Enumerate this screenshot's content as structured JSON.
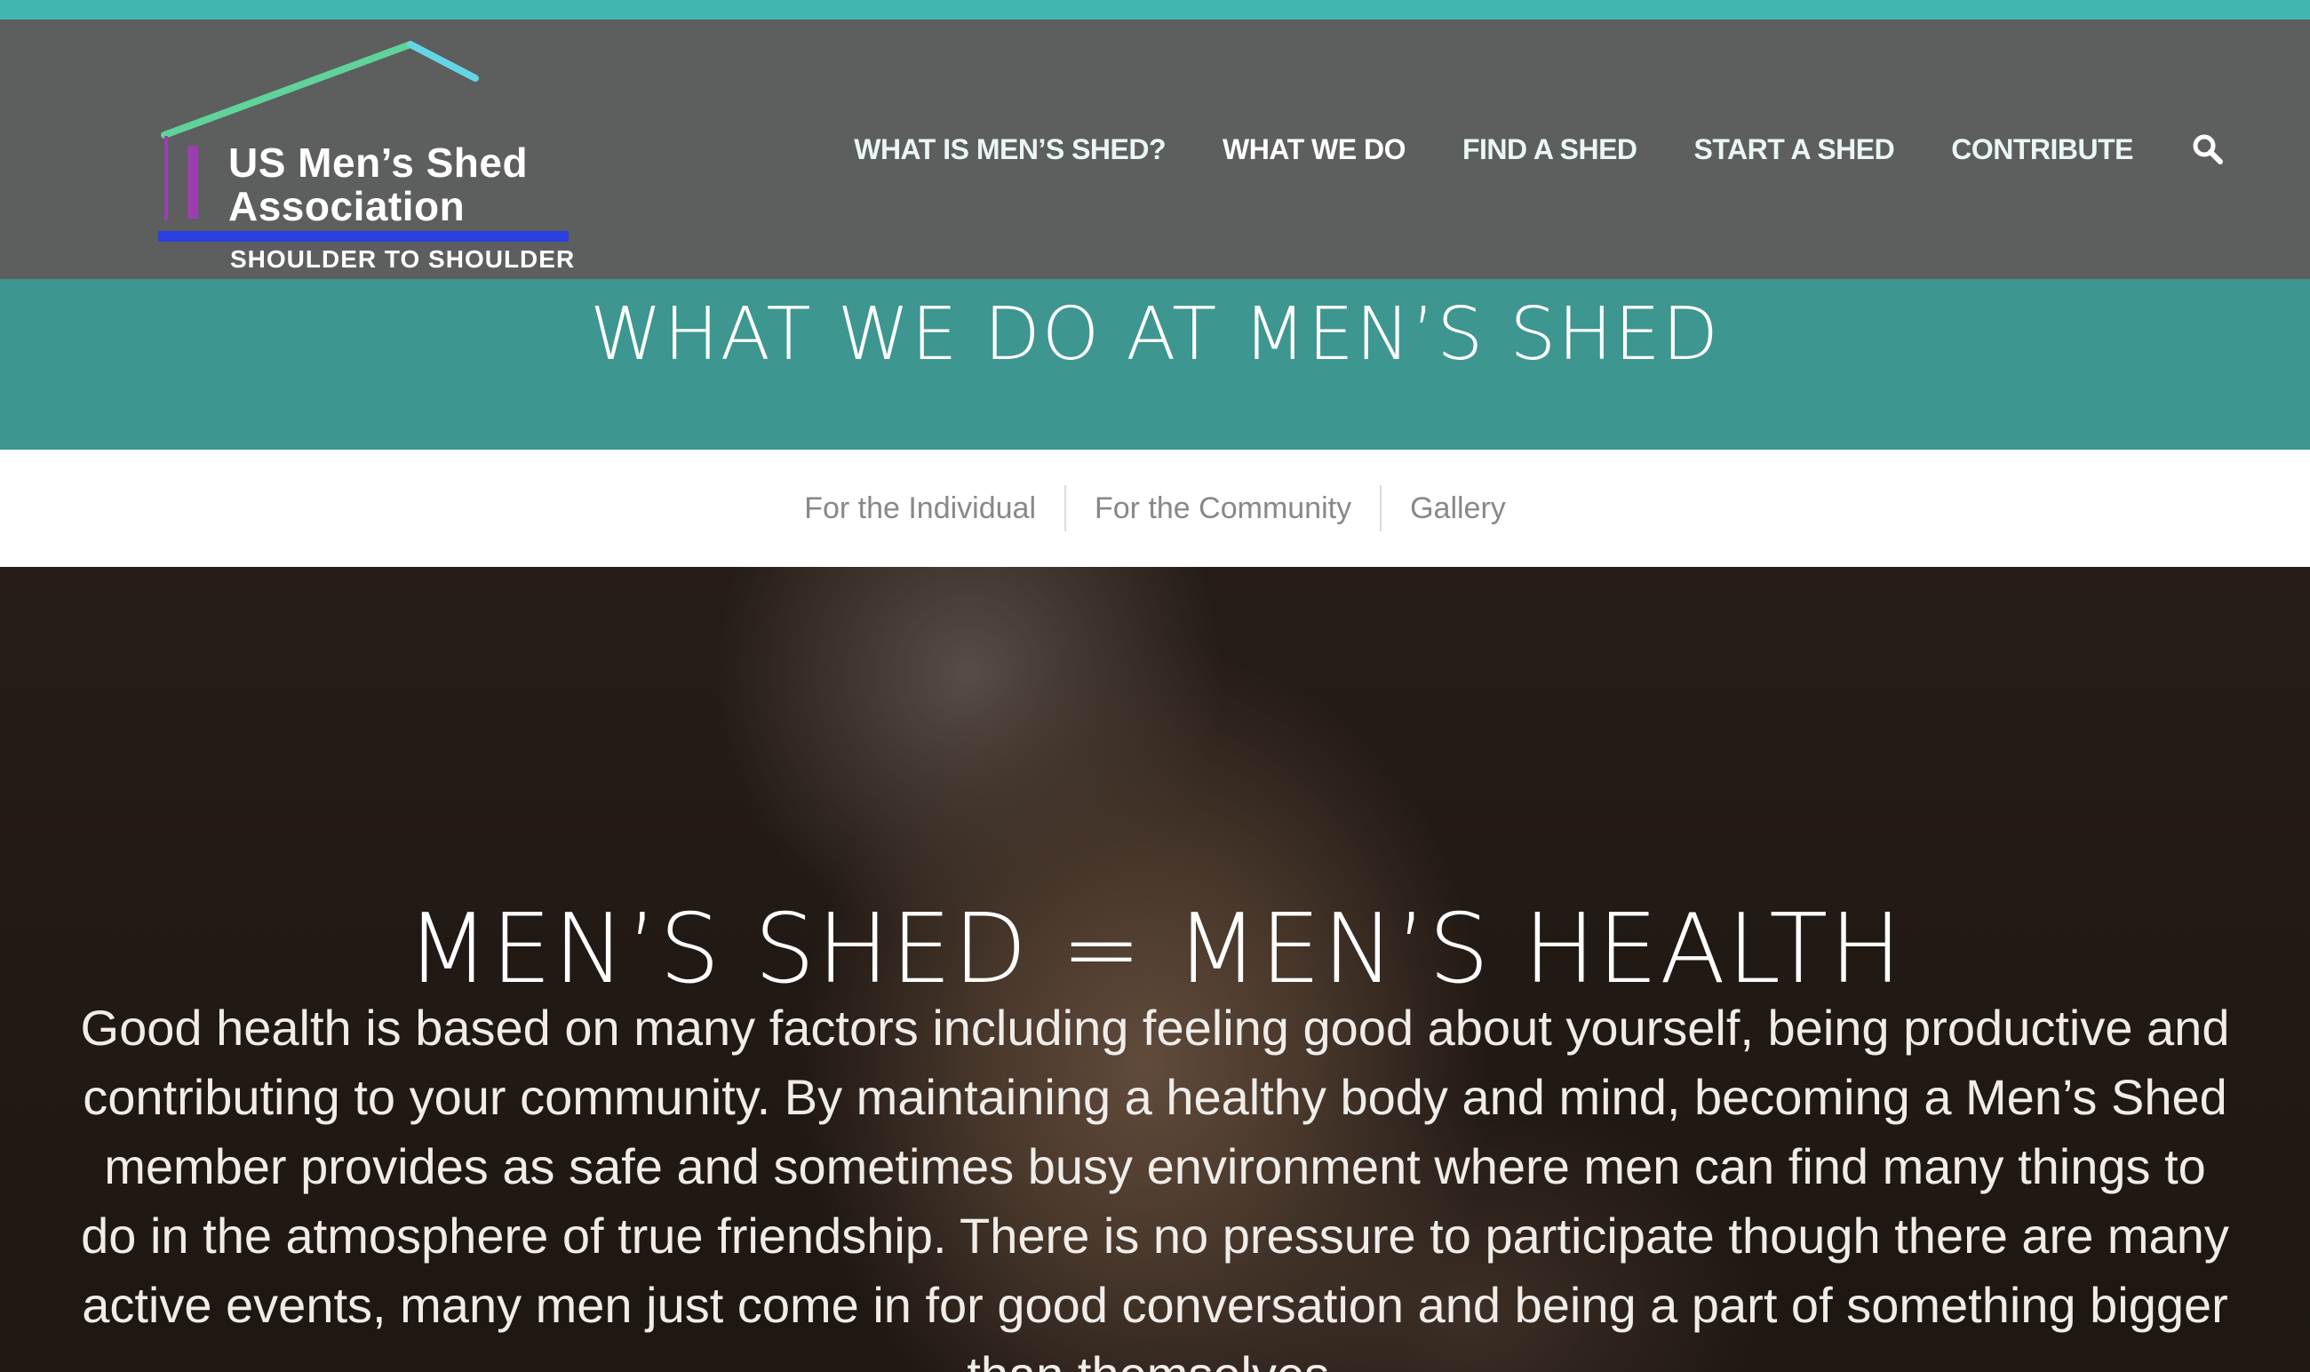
{
  "brand": {
    "name_line1": "US Men’s Shed",
    "name_line2": "Association",
    "tagline": "SHOULDER TO SHOULDER",
    "colors": {
      "top_strip": "#3fb7af",
      "header_bg": "#5d5e5e",
      "roof_green": "#5fd39a",
      "roof_cyan": "#63d6e6",
      "wall_purple": "#9b3fb0",
      "floor_blue": "#2a3fe0"
    }
  },
  "nav": {
    "items": [
      {
        "label": "WHAT IS MEN’S SHED?"
      },
      {
        "label": "WHAT WE DO"
      },
      {
        "label": "FIND A SHED"
      },
      {
        "label": "START A SHED"
      },
      {
        "label": "CONTRIBUTE"
      }
    ],
    "search_icon": "search-icon"
  },
  "title_band": {
    "title": "WHAT WE DO AT MEN’S SHED",
    "color": "#3d968f"
  },
  "sub_nav": {
    "items": [
      {
        "label": "For the Individual"
      },
      {
        "label": "For the Community"
      },
      {
        "label": "Gallery"
      }
    ]
  },
  "hero": {
    "heading": "MEN’S SHED = MEN’S HEALTH",
    "body": "Good health is based on many factors including feeling good about yourself, being productive and contributing to your community. By maintaining a healthy body and mind, becoming a Men’s Shed member provides as safe and sometimes busy environment where men can find many things to do in the atmosphere of true friendship. There is no pressure to participate though there are many active events, many men just come in for good conversation and being a part of something bigger than themselves."
  }
}
